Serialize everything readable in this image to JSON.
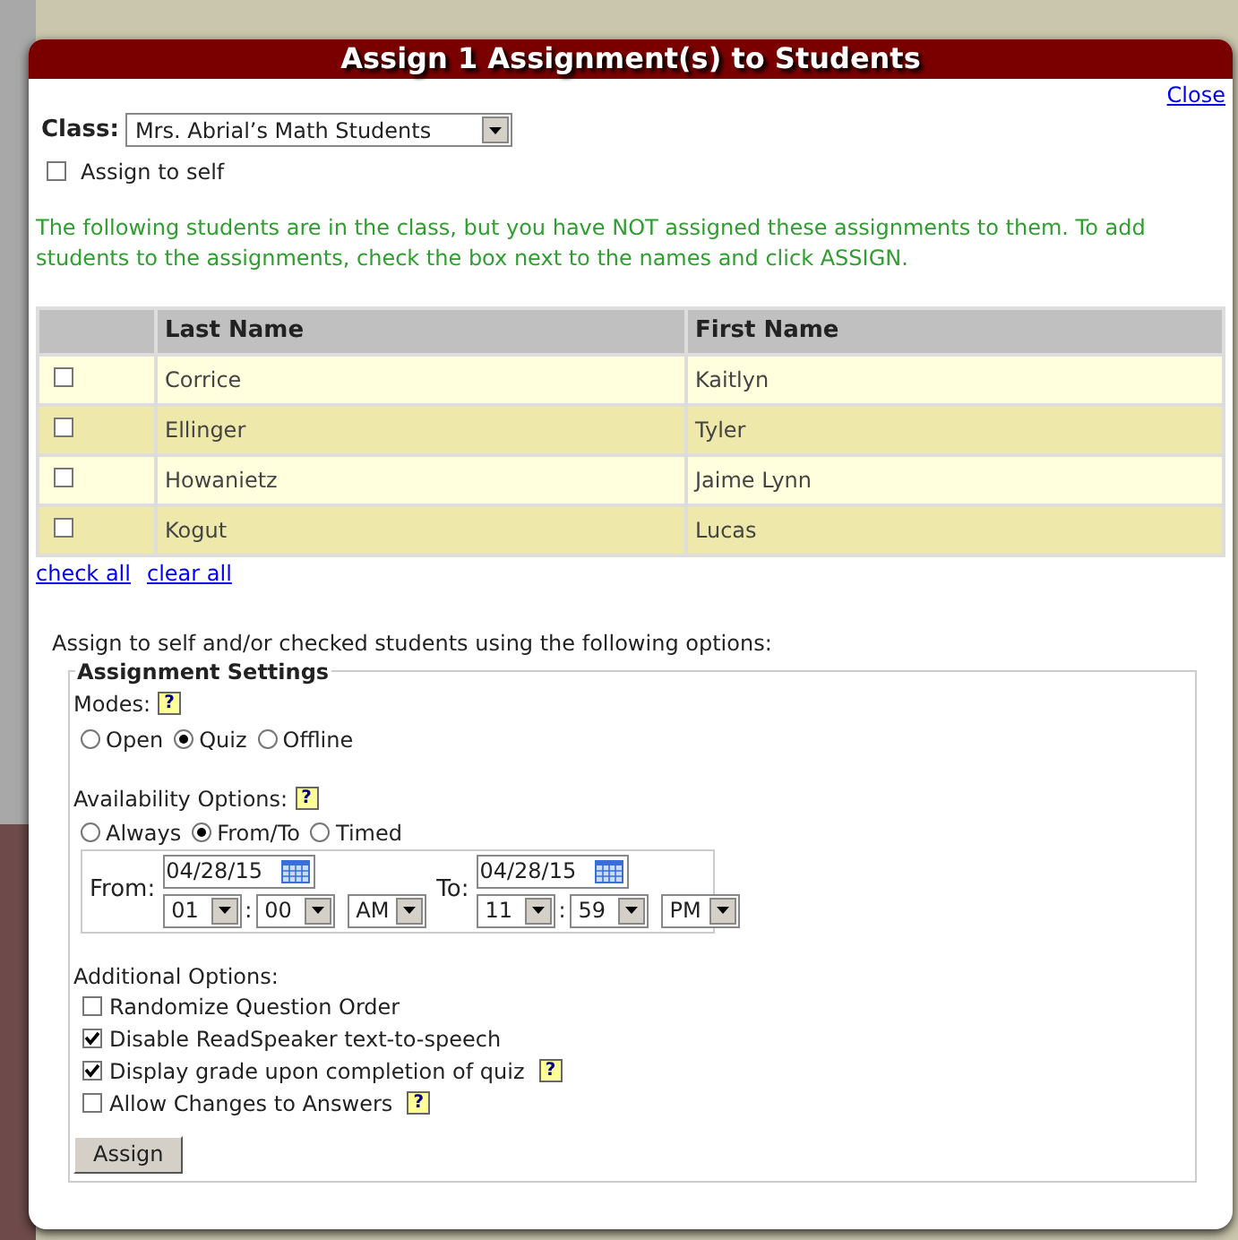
{
  "title": "Assign 1 Assignment(s) to Students",
  "close_link": "Close",
  "class_field": {
    "label": "Class:",
    "value": "Mrs. Abrial’s Math Students"
  },
  "assign_to_self": {
    "label": "Assign to self",
    "checked": false
  },
  "notice": "The following students are in the class, but you have NOT assigned these assignments to them. To add students to the assignments, check the box next to the names and click ASSIGN.",
  "table": {
    "columns": [
      "Last Name",
      "First Name"
    ],
    "rows": [
      {
        "checked": false,
        "last_name": "Corrice",
        "first_name": "Kaitlyn"
      },
      {
        "checked": false,
        "last_name": "Ellinger",
        "first_name": "Tyler"
      },
      {
        "checked": false,
        "last_name": "Howanietz",
        "first_name": "Jaime Lynn"
      },
      {
        "checked": false,
        "last_name": "Kogut",
        "first_name": "Lucas"
      }
    ]
  },
  "table_links": [
    "check all",
    "clear all"
  ],
  "instructions": "Assign to self and/or checked students using the following options:",
  "settings": {
    "legend": "Assignment Settings",
    "modes": {
      "label": "Modes:",
      "help": "?",
      "options": [
        {
          "label": "Open",
          "selected": false
        },
        {
          "label": "Quiz",
          "selected": true
        },
        {
          "label": "Offline",
          "selected": false
        }
      ]
    },
    "availability": {
      "label": "Availability Options:",
      "help": "?",
      "options": [
        {
          "label": "Always",
          "selected": false
        },
        {
          "label": "From/To",
          "selected": true
        },
        {
          "label": "Timed",
          "selected": false
        }
      ]
    },
    "from": {
      "label": "From:",
      "date": "04/28/15",
      "hour": "01",
      "separator": ":",
      "minute": "00",
      "ampm": "AM"
    },
    "to": {
      "label": "To:",
      "date": "04/28/15",
      "hour": "11",
      "separator": ":",
      "minute": "59",
      "ampm": "PM"
    },
    "additional": {
      "label": "Additional Options:",
      "options": [
        {
          "label": "Randomize Question Order",
          "checked": false
        },
        {
          "label": "Disable ReadSpeaker text-to-speech",
          "checked": true
        },
        {
          "label": "Display grade upon completion of quiz",
          "checked": true,
          "help": "?"
        },
        {
          "label": "Allow Changes to Answers",
          "checked": false,
          "help": "?"
        }
      ]
    },
    "assign_button": "Assign"
  }
}
